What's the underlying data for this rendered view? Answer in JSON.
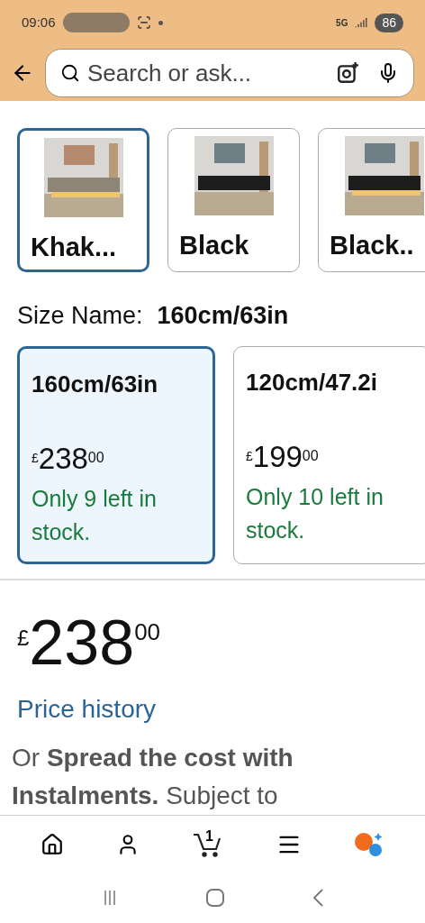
{
  "status_bar": {
    "time": "09:06",
    "network": "5G",
    "battery": "86"
  },
  "search": {
    "placeholder": "Search or ask..."
  },
  "colour_options": [
    {
      "label": "Khak...",
      "selected": true
    },
    {
      "label": "Black",
      "selected": false
    },
    {
      "label": "Black..",
      "selected": false
    }
  ],
  "size": {
    "label": "Size Name:",
    "value": "160cm/63in"
  },
  "size_options": [
    {
      "label": "160cm/63in",
      "currency": "£",
      "whole": "238",
      "fraction": "00",
      "stock": "Only 9 left in stock.",
      "selected": true
    },
    {
      "label": "120cm/47.2i",
      "currency": "£",
      "whole": "199",
      "fraction": "00",
      "stock": "Only 10 left in stock.",
      "selected": false
    }
  ],
  "price": {
    "currency": "£",
    "whole": "238",
    "fraction": "00"
  },
  "price_history_link": "Price history",
  "instalments_text": "Or **Spread the cost with Instalments.** Subject to",
  "bottom_nav": {
    "cart_count": "1"
  }
}
